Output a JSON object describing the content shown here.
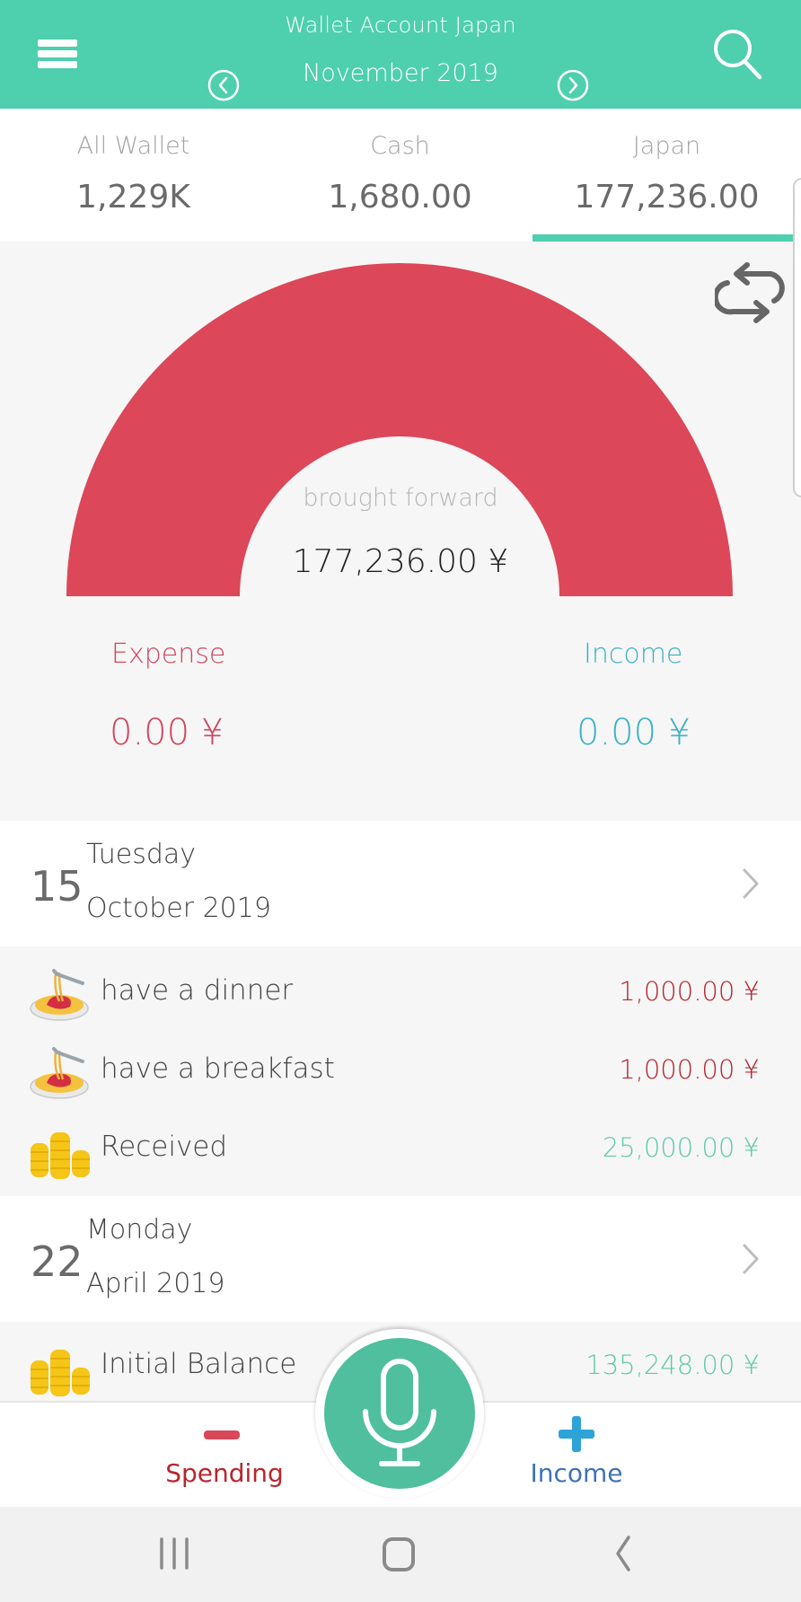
{
  "header": {
    "title": "Wallet Account Japan",
    "month": "November 2019",
    "icons": {
      "menu": "hamburger-icon",
      "prev": "chevron-left-circle-icon",
      "next": "chevron-right-circle-icon",
      "search": "search-icon"
    }
  },
  "wallet_tabs": [
    {
      "label": "All Wallet",
      "value": "1,229K",
      "active": false
    },
    {
      "label": "Cash",
      "value": "1,680.00",
      "active": false
    },
    {
      "label": "Japan",
      "value": "177,236.00",
      "active": true
    }
  ],
  "summary": {
    "gauge": {
      "expense_fraction": 1.0,
      "color": "#dc4759"
    },
    "brought_forward_label": "brought forward",
    "brought_forward_value": "177,236.00 ¥",
    "expense_label": "Expense",
    "expense_value": "0.00 ¥",
    "income_label": "Income",
    "income_value": "0.00 ¥",
    "refresh_icon": "refresh-icon"
  },
  "groups": [
    {
      "day": "15",
      "weekday": "Tuesday",
      "month_year": "October 2019",
      "transactions": [
        {
          "icon": "spaghetti-icon",
          "name": "have a dinner",
          "amount": "1,000.00 ¥",
          "type": "expense"
        },
        {
          "icon": "spaghetti-icon",
          "name": "have a breakfast",
          "amount": "1,000.00 ¥",
          "type": "expense"
        },
        {
          "icon": "coins-icon",
          "name": "Received",
          "amount": "25,000.00 ¥",
          "type": "income"
        }
      ]
    },
    {
      "day": "22",
      "weekday": "Monday",
      "month_year": "April 2019",
      "transactions": [
        {
          "icon": "coins-icon",
          "name": "Initial Balance",
          "amount": "135,248.00 ¥",
          "type": "income"
        }
      ]
    }
  ],
  "bottom_bar": {
    "spending_label": "Spending",
    "income_label": "Income",
    "mic_icon": "microphone-icon"
  },
  "colors": {
    "accent": "#4ecfae",
    "expense": "#cf4760",
    "income": "#3fb1c6",
    "expense_amount": "#b5272d",
    "income_amount": "#5fc9aa"
  }
}
